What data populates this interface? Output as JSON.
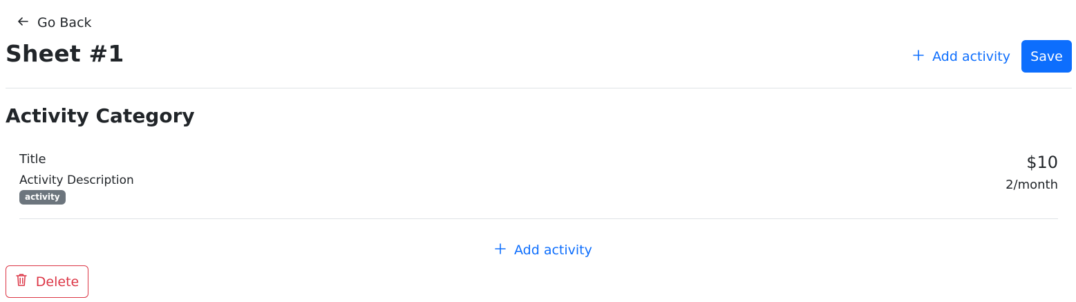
{
  "nav": {
    "back_label": "Go Back",
    "back_icon": "arrow-left-icon"
  },
  "header": {
    "title": "Sheet #1",
    "add_activity_label": "Add activity",
    "save_label": "Save"
  },
  "category": {
    "title": "Activity Category",
    "activities": [
      {
        "title": "Title",
        "description": "Activity Description",
        "badge": "activity",
        "price": "$10",
        "frequency": "2/month"
      }
    ],
    "add_activity_label": "Add activity"
  },
  "footer": {
    "delete_label": "Delete",
    "delete_icon": "trash-icon"
  },
  "colors": {
    "primary": "#0d6efd",
    "danger": "#dc3545",
    "badge": "#6c757d",
    "divider": "#dee2e6",
    "text": "#212529"
  }
}
